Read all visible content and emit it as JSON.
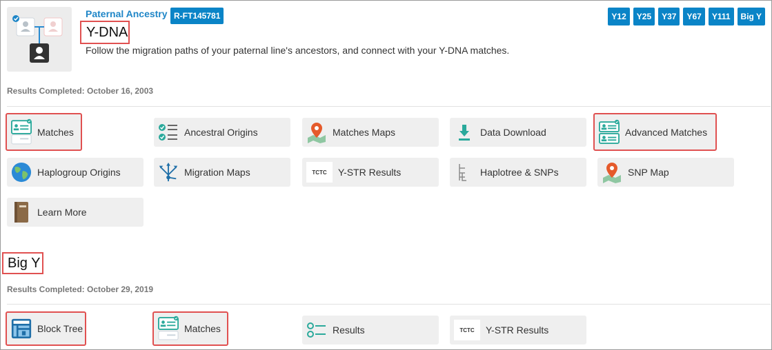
{
  "header": {
    "ancestry_label": "Paternal Ancestry",
    "haplogroup": "R-FT145781",
    "title": "Y-DNA",
    "description": "Follow the migration paths of your paternal line's ancestors, and connect with your Y-DNA matches.",
    "tests": [
      "Y12",
      "Y25",
      "Y37",
      "Y67",
      "Y111",
      "Big Y"
    ]
  },
  "ydna": {
    "results_completed": "Results Completed: October 16, 2003",
    "tiles": [
      {
        "label": "Matches",
        "icon": "matches-card-icon"
      },
      {
        "label": "Ancestral Origins",
        "icon": "checklist-icon"
      },
      {
        "label": "Matches Maps",
        "icon": "map-pin-icon"
      },
      {
        "label": "Data Download",
        "icon": "download-icon"
      },
      {
        "label": "Advanced Matches",
        "icon": "advanced-matches-icon"
      },
      {
        "label": "Haplogroup Origins",
        "icon": "globe-icon"
      },
      {
        "label": "Migration Maps",
        "icon": "migration-arrows-icon"
      },
      {
        "label": "Y-STR Results",
        "icon": "tctc-icon"
      },
      {
        "label": "Haplotree & SNPs",
        "icon": "tree-icon"
      },
      {
        "label": "SNP Map",
        "icon": "map-pin-icon"
      },
      {
        "label": "Learn More",
        "icon": "book-icon"
      }
    ]
  },
  "bigy": {
    "title": "Big Y",
    "results_completed": "Results Completed: October 29, 2019",
    "tiles": [
      {
        "label": "Block Tree",
        "icon": "block-tree-icon"
      },
      {
        "label": "Matches",
        "icon": "matches-card-icon"
      },
      {
        "label": "Results",
        "icon": "results-list-icon"
      },
      {
        "label": "Y-STR Results",
        "icon": "tctc-icon"
      }
    ]
  },
  "icon_text": {
    "tctc": "TCTC"
  },
  "colors": {
    "brand_blue": "#0a84c7",
    "teal": "#2aa99b",
    "highlight": "#e05050",
    "tile_bg": "#efefef"
  }
}
